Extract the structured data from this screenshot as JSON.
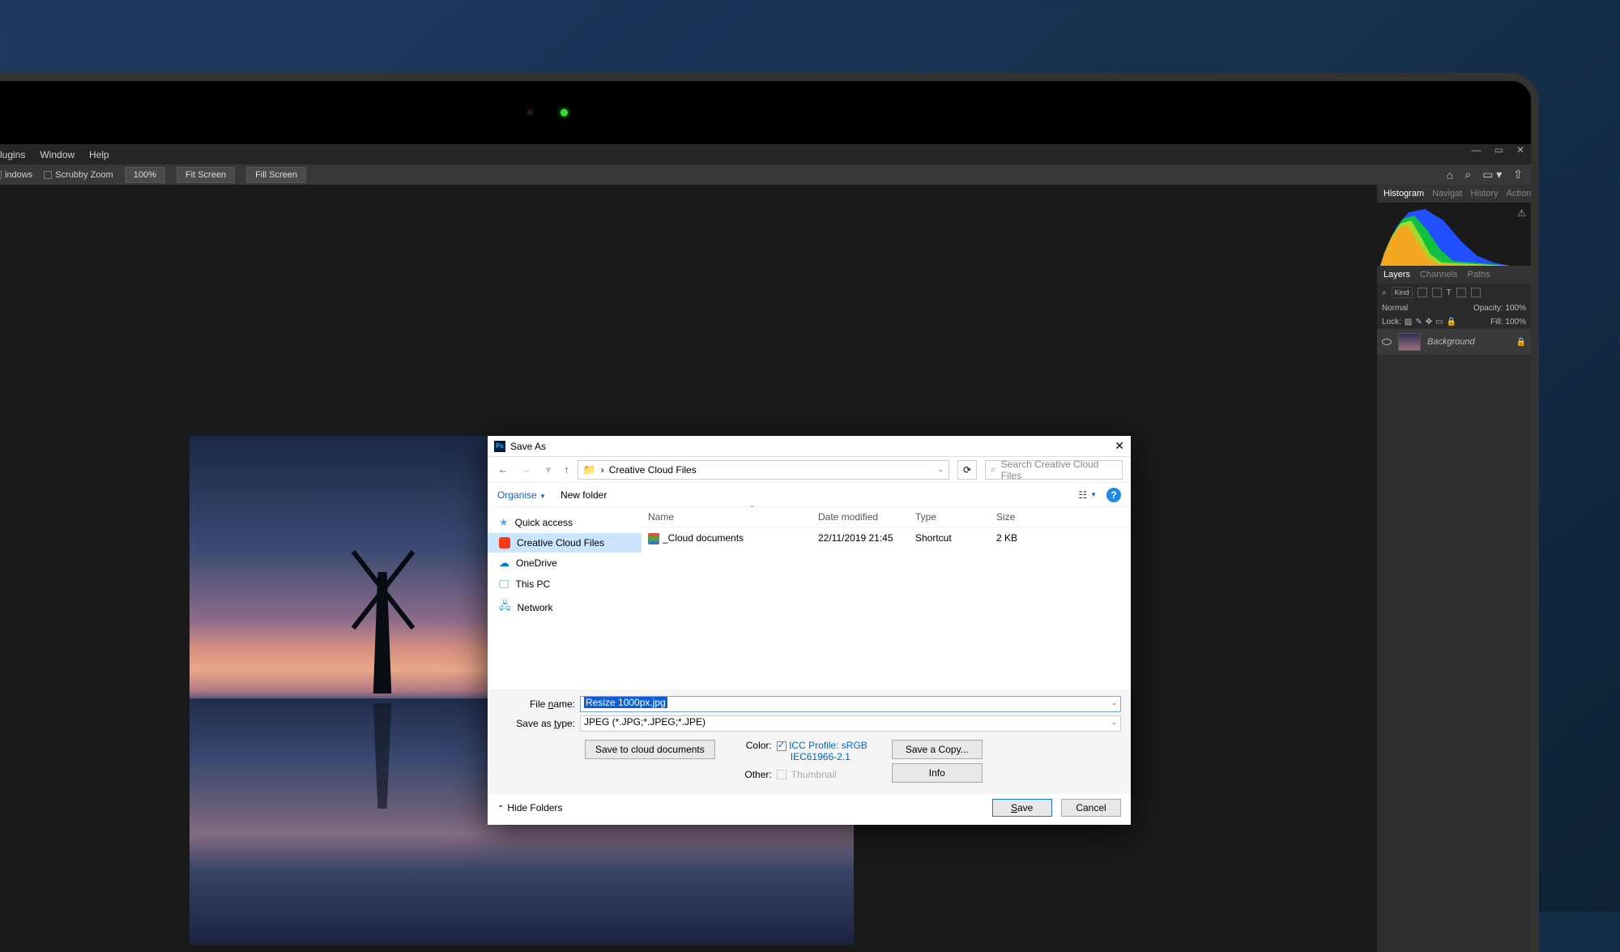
{
  "menubar": {
    "plugins": "Plugins",
    "window": "Window",
    "help": "Help"
  },
  "optionsbar": {
    "windows_check": "indows",
    "scrubby": "Scrubby Zoom",
    "pct100": "100%",
    "fit": "Fit Screen",
    "fill": "Fill Screen"
  },
  "panels": {
    "tabs1": {
      "histogram": "Histogram",
      "navigat": "Navigat",
      "history": "History",
      "actions": "Actions"
    },
    "tabs2": {
      "layers": "Layers",
      "channels": "Channels",
      "paths": "Paths"
    },
    "kind": "Kind",
    "blend": "Normal",
    "opacity_label": "Opacity:",
    "opacity_val": "100%",
    "lock_label": "Lock:",
    "fill_label": "Fill:",
    "fill_val": "100%",
    "layer_name": "Background"
  },
  "dialog": {
    "title": "Save As",
    "breadcrumb": "Creative Cloud Files",
    "search_placeholder": "Search Creative Cloud Files",
    "organise": "Organise",
    "new_folder": "New folder",
    "sidebar": {
      "quick": "Quick access",
      "cc": "Creative Cloud Files",
      "onedrive": "OneDrive",
      "thispc": "This PC",
      "network": "Network"
    },
    "columns": {
      "name": "Name",
      "date": "Date modified",
      "type": "Type",
      "size": "Size"
    },
    "rows": [
      {
        "name": "_Cloud documents",
        "date": "22/11/2019 21:45",
        "type": "Shortcut",
        "size": "2 KB"
      }
    ],
    "filename_label": "File name:",
    "filename_value": "Resize 1000px.jpg",
    "saveastype_label": "Save as type:",
    "saveastype_value": "JPEG (*.JPG;*.JPEG;*.JPE)",
    "save_cloud": "Save to cloud documents",
    "color_label": "Color:",
    "icc_line1": "ICC Profile: sRGB",
    "icc_line2": "IEC61966-2.1",
    "other_label": "Other:",
    "thumbnail": "Thumbnail",
    "save_copy": "Save a Copy...",
    "info": "Info",
    "hide_folders": "Hide Folders",
    "save": "Save",
    "cancel": "Cancel"
  }
}
